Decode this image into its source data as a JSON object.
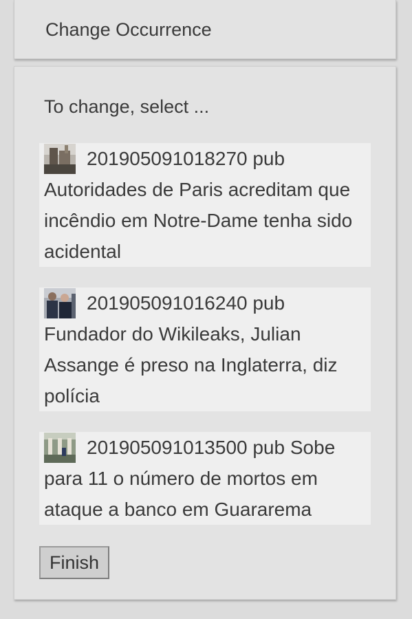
{
  "header": {
    "title": "Change Occurrence"
  },
  "prompt": "To change, select ...",
  "items": [
    {
      "id": "201905091018270 pub",
      "text": "Autoridades de Paris acreditam que incêndio em Notre-Dame tenha sido acidental",
      "thumb_icon": "notre-dame-photo"
    },
    {
      "id": "201905091016240 pub",
      "text": "Fundador do Wikileaks, Julian Assange é preso na Inglaterra, diz polícia",
      "thumb_icon": "assange-arrest-photo"
    },
    {
      "id": "201905091013500 pub",
      "text": "Sobe para 11 o número de mortos em ataque a banco em Guararema",
      "thumb_icon": "bank-attack-photo"
    }
  ],
  "finish_label": "Finish"
}
